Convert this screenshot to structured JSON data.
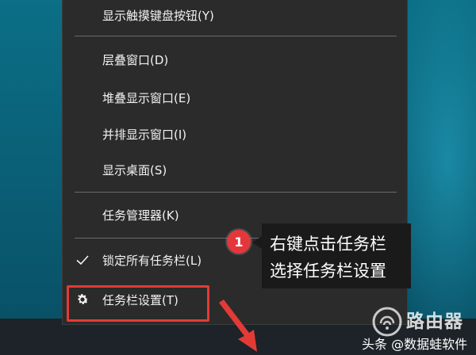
{
  "context_menu": {
    "items": [
      {
        "id": "show-touch-keyboard",
        "label": "显示触摸键盘按钮(Y)"
      },
      {
        "id": "cascade-windows",
        "label": "层叠窗口(D)"
      },
      {
        "id": "stack-windows",
        "label": "堆叠显示窗口(E)"
      },
      {
        "id": "side-by-side",
        "label": "并排显示窗口(I)"
      },
      {
        "id": "show-desktop",
        "label": "显示桌面(S)"
      },
      {
        "id": "task-manager",
        "label": "任务管理器(K)"
      },
      {
        "id": "lock-taskbars",
        "label": "锁定所有任务栏(L)",
        "icon": "checkmark-icon",
        "checked": true
      },
      {
        "id": "taskbar-settings",
        "label": "任务栏设置(T)",
        "icon": "gear-icon"
      }
    ]
  },
  "annotation": {
    "step_number": "1",
    "line1": "右键点击任务栏",
    "line2": "选择任务栏设置",
    "highlight_color": "#e23b36",
    "badge_color": "#e5373b"
  },
  "watermark": {
    "title": "路由器",
    "source": "头条 @数据蛙软件"
  }
}
